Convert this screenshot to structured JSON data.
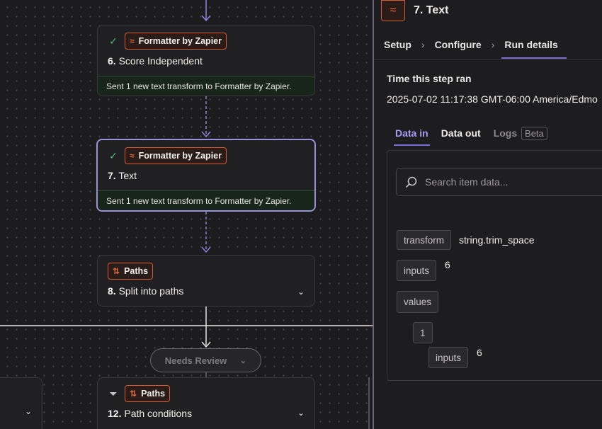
{
  "canvas": {
    "nodes": [
      {
        "app": "Formatter by Zapier",
        "step": "6.",
        "title": "Score Independent",
        "status": "Sent 1 new text transform to Formatter by Zapier."
      },
      {
        "app": "Formatter by Zapier",
        "step": "7.",
        "title": "Text",
        "status": "Sent 1 new text transform to Formatter by Zapier."
      },
      {
        "app": "Paths",
        "step": "8.",
        "title": "Split into paths"
      },
      {
        "app": "Paths",
        "step": "12.",
        "title": "Path conditions"
      }
    ],
    "branch_pill": "Needs Review"
  },
  "panel": {
    "title": "7. Text",
    "breadcrumbs": [
      "Setup",
      "Configure",
      "Run details"
    ],
    "time_label": "Time this step ran",
    "time_value": "2025-07-02 11:17:38 GMT-06:00 America/Edmo",
    "tabs": {
      "data_in": "Data in",
      "data_out": "Data out",
      "logs": "Logs",
      "beta": "Beta"
    },
    "search_placeholder": "Search item data...",
    "data": {
      "transform_key": "transform",
      "transform_value": "string.trim_space",
      "inputs_key": "inputs",
      "inputs_value": "6",
      "values_key": "values",
      "index_key": "1",
      "nested_inputs_key": "inputs",
      "nested_inputs_value": "6"
    }
  },
  "colors": {
    "accent": "#7d6fe0",
    "brand": "#d35a34",
    "success": "#4fbf76"
  }
}
